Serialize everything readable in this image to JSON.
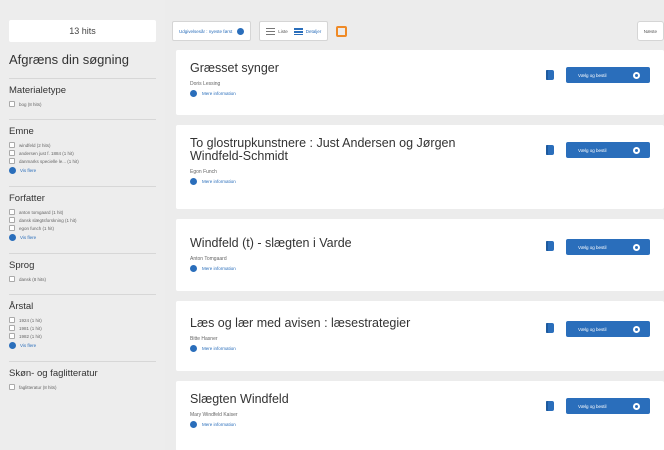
{
  "sidebar": {
    "hits": "13 hits",
    "refine_title": "Afgræns din søgning",
    "facets": [
      {
        "title": "Materialetype",
        "items": [
          "bog (8 hits)"
        ],
        "more": ""
      },
      {
        "title": "Emne",
        "items": [
          "windfeld (2 hits)",
          "andersen just f. 1884 (1 hit)",
          "danmarks specielle le... (1 hit)"
        ],
        "more": "Vis flere"
      },
      {
        "title": "Forfatter",
        "items": [
          "anton tomgaard (1 hit)",
          "dansk slægtsforskning (1 hit)",
          "egon funch (1 hit)"
        ],
        "more": "Vis flere"
      },
      {
        "title": "Sprog",
        "items": [
          "dansk (8 hits)"
        ],
        "more": ""
      },
      {
        "title": "Årstal",
        "items": [
          "1924 (1 hit)",
          "1981 (1 hit)",
          "1982 (1 hit)"
        ],
        "more": "Vis flere"
      },
      {
        "title": "Skøn- og faglitteratur",
        "items": [
          "faglitteratur (8 hits)"
        ],
        "more": ""
      }
    ]
  },
  "toolbar": {
    "sort_label": "Udgivelsesår : nyeste først",
    "list_label": "Liste",
    "detail_label": "Detaljer",
    "next_label": "Næste"
  },
  "results": [
    {
      "title": "Græsset synger",
      "author": "Doris Lessing",
      "more": "Mere information",
      "order": "Vælg og bestil"
    },
    {
      "title": "To glostrupkunstnere : Just Andersen og Jørgen Windfeld-Schmidt",
      "author": "Egon Funch",
      "more": "Mere information",
      "order": "Vælg og bestil"
    },
    {
      "title": "Windfeld (t) - slægten i Varde",
      "author": "Anton Tomgaard",
      "more": "Mere information",
      "order": "Vælg og bestil"
    },
    {
      "title": "Læs og lær med avisen : læsestrategier",
      "author": "Bitte Hasner",
      "more": "Mere information",
      "order": "Vælg og bestil"
    },
    {
      "title": "Slægten Windfeld",
      "author": "Mary Windfeld Kaiser",
      "more": "Mere information",
      "order": "Vælg og bestil"
    }
  ]
}
